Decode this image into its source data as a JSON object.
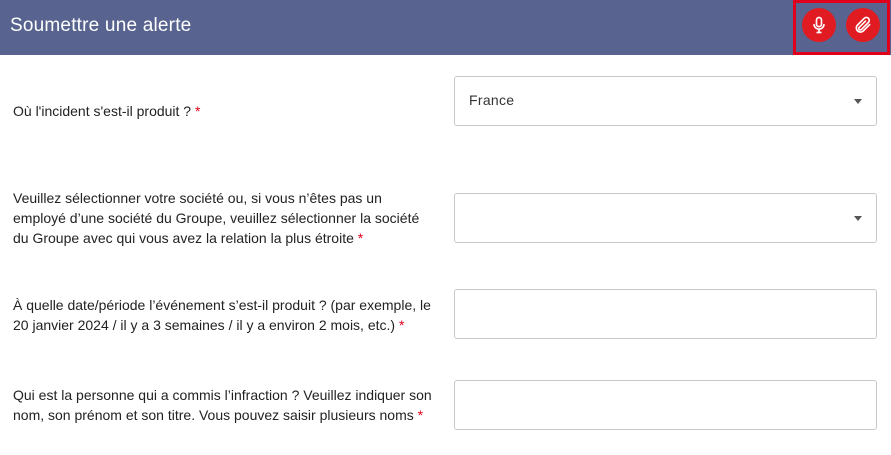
{
  "header": {
    "title": "Soumettre une alerte",
    "icons": {
      "mic": "microphone-icon",
      "clip": "paperclip-icon"
    },
    "bg_color": "#58648f",
    "accent_color": "#e11b22"
  },
  "questions": [
    {
      "label": "Où l'incident s'est-il produit ?",
      "required_mark": "*",
      "type": "select",
      "value": "France"
    },
    {
      "label": "Veuillez sélectionner votre société ou, si vous n’êtes pas un employé d’une société du Groupe, veuillez sélectionner la société du Groupe avec qui vous avez la relation la plus étroite",
      "required_mark": "*",
      "type": "select",
      "value": ""
    },
    {
      "label": "À quelle date/période l’événement s’est-il produit ? (par exemple, le 20 janvier 2024 / il y a 3 semaines / il y a environ 2 mois, etc.)",
      "required_mark": "*",
      "type": "text",
      "value": ""
    },
    {
      "label": "Qui est la personne qui a commis l’infraction ? Veuillez indiquer son nom, son prénom et son titre. Vous pouvez saisir plusieurs noms",
      "required_mark": "*",
      "type": "text",
      "value": ""
    }
  ]
}
